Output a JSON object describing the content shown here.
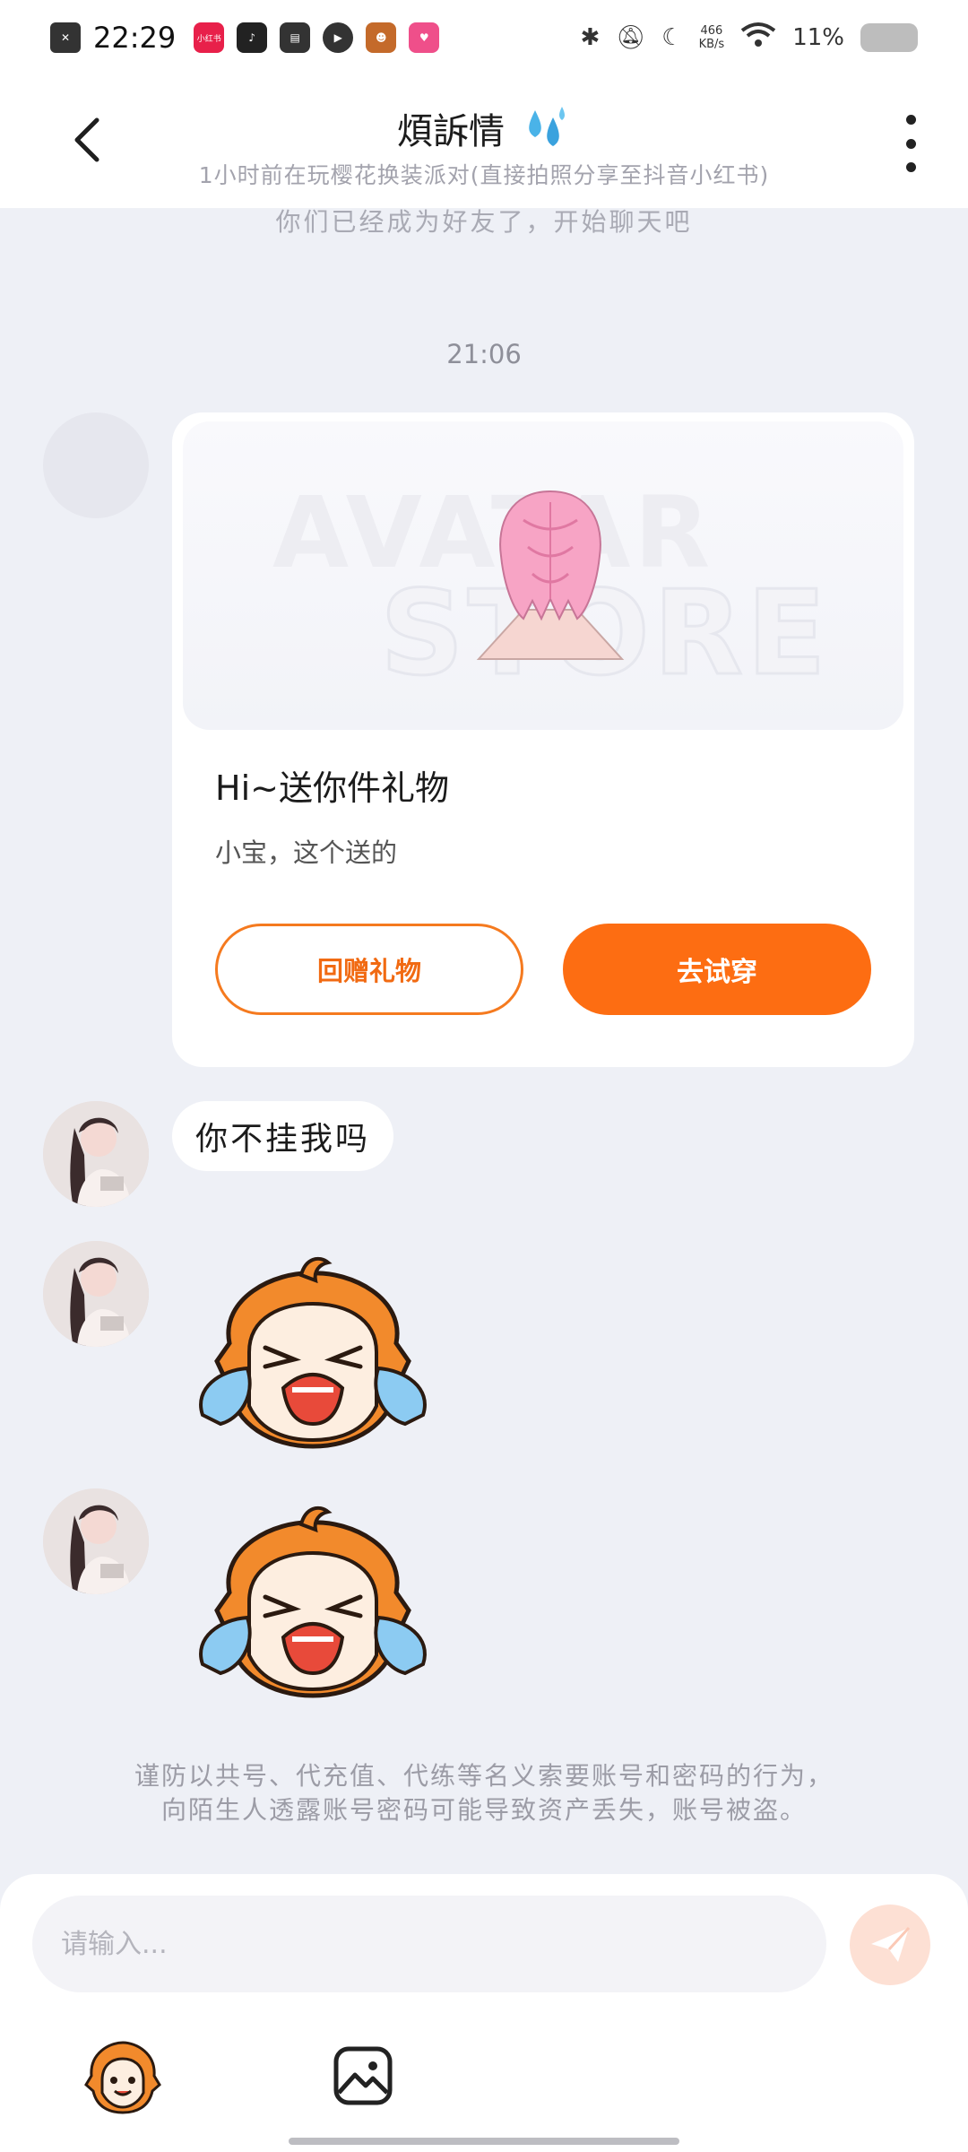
{
  "status_bar": {
    "time": "22:29",
    "app_badge_label": "小红书",
    "speed_value": "466",
    "speed_unit": "KB/s",
    "battery": "11%"
  },
  "header": {
    "title": "煩訴情",
    "subtitle": "1小时前在玩樱花换装派对(直接拍照分享至抖音小红书)"
  },
  "chat": {
    "system_message": "你们已经成为好友了，开始聊天吧",
    "timestamp": "21:06",
    "gift_card": {
      "watermark_line1": "AVATAR",
      "watermark_line2": "STORE",
      "title": "Hi~送你件礼物",
      "description": "小宝，这个送的",
      "return_gift_label": "回赠礼物",
      "try_on_label": "去试穿"
    },
    "text_message": "你不挂我吗",
    "security_notice_line1": "谨防以共号、代充值、代练等名义索要账号和密码的行为，",
    "security_notice_line2": "向陌生人透露账号密码可能导致资产丢失，账号被盗。"
  },
  "input_bar": {
    "placeholder": "请输入..."
  },
  "colors": {
    "accent": "#fd6d12",
    "background": "#eef0f6",
    "bubble": "#ffffff"
  },
  "icons": [
    "back-icon",
    "more-icon",
    "water-drops-icon",
    "send-icon",
    "emoji-mascot-icon",
    "image-icon"
  ]
}
